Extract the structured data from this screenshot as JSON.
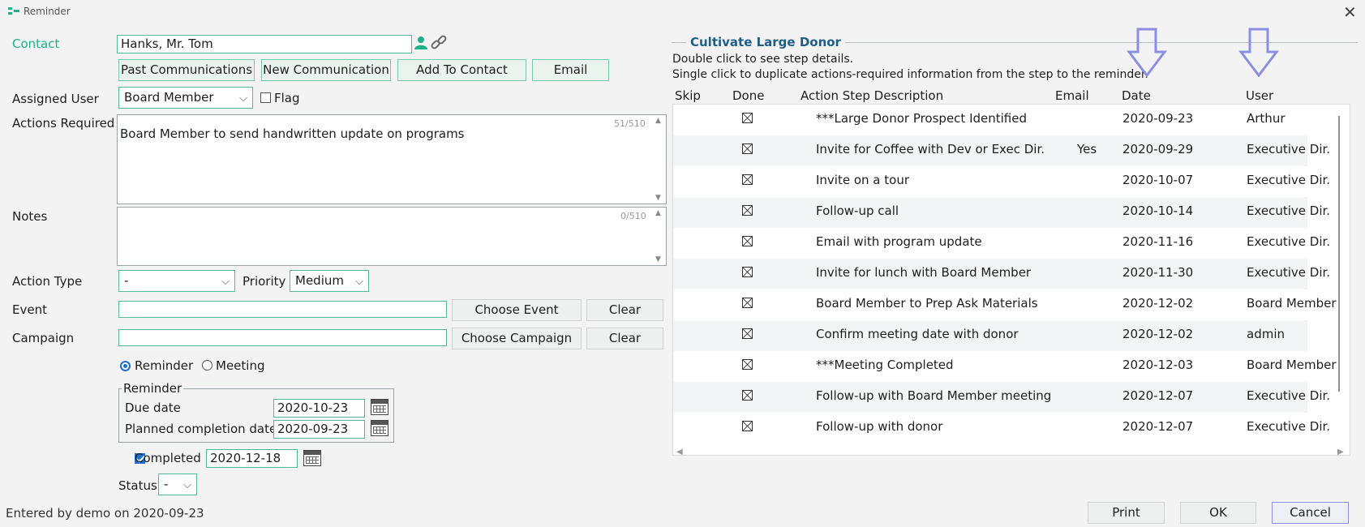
{
  "window": {
    "title": "Reminder",
    "close_icon": "close-icon"
  },
  "contact": {
    "label": "Contact",
    "value": "Hanks, Mr. Tom"
  },
  "contact_buttons": {
    "past": "Past Communications",
    "new": "New Communication",
    "add": "Add To Contact",
    "email": "Email"
  },
  "assigned_user": {
    "label": "Assigned User",
    "value": "Board Member",
    "flag_label": "Flag"
  },
  "actions_required": {
    "label": "Actions Required",
    "text": "Board Member to send handwritten update on programs",
    "counter": "51/510"
  },
  "notes": {
    "label": "Notes",
    "text": "",
    "counter": "0/510"
  },
  "action_type": {
    "label": "Action Type",
    "value": "-",
    "priority_label": "Priority",
    "priority_value": "Medium"
  },
  "event": {
    "label": "Event",
    "value": "",
    "choose": "Choose Event",
    "clear": "Clear"
  },
  "campaign": {
    "label": "Campaign",
    "value": "",
    "choose": "Choose Campaign",
    "clear": "Clear"
  },
  "mode": {
    "reminder": "Reminder",
    "meeting": "Meeting",
    "selected": "Reminder"
  },
  "reminder_group": {
    "title": "Reminder",
    "due_label": "Due date",
    "due_value": "2020-10-23",
    "planned_label": "Planned completion date",
    "planned_value": "2020-09-23"
  },
  "completed": {
    "label": "Completed",
    "value": "2020-12-18",
    "checked": true
  },
  "status": {
    "label": "Status",
    "value": "-"
  },
  "entered_by": "Entered by demo on 2020-09-23",
  "steps": {
    "title": "Cultivate Large Donor",
    "hint1": "Double click to see step details.",
    "hint2": "Single click to duplicate actions-required information from the step to the reminder.",
    "columns": {
      "skip": "Skip",
      "done": "Done",
      "desc": "Action Step Description",
      "email": "Email",
      "date": "Date",
      "user": "User"
    },
    "rows": [
      {
        "desc": "***Large Donor Prospect Identified",
        "email": "",
        "date": "2020-09-23",
        "user": "Arthur"
      },
      {
        "desc": "Invite for Coffee with Dev or Exec Dir.",
        "email": "Yes",
        "date": "2020-09-29",
        "user": "Executive Dir."
      },
      {
        "desc": "Invite on a tour",
        "email": "",
        "date": "2020-10-07",
        "user": "Executive Dir."
      },
      {
        "desc": "Follow-up call",
        "email": "",
        "date": "2020-10-14",
        "user": "Executive Dir."
      },
      {
        "desc": "Email with program update",
        "email": "",
        "date": "2020-11-16",
        "user": "Executive Dir."
      },
      {
        "desc": "Invite for lunch with Board Member",
        "email": "",
        "date": "2020-11-30",
        "user": "Executive Dir."
      },
      {
        "desc": "Board Member to Prep Ask Materials",
        "email": "",
        "date": "2020-12-02",
        "user": "Board Member"
      },
      {
        "desc": "Confirm meeting date with donor",
        "email": "",
        "date": "2020-12-02",
        "user": "admin"
      },
      {
        "desc": "***Meeting Completed",
        "email": "",
        "date": "2020-12-03",
        "user": "Board Member"
      },
      {
        "desc": "Follow-up with Board Member meeting",
        "email": "",
        "date": "2020-12-07",
        "user": "Executive Dir."
      },
      {
        "desc": "Follow-up with donor",
        "email": "",
        "date": "2020-12-07",
        "user": "Executive Dir."
      }
    ]
  },
  "footer": {
    "print": "Print",
    "ok": "OK",
    "cancel": "Cancel"
  },
  "colors": {
    "accent": "#1fb08a",
    "arrow": "#8c8fe0",
    "section": "#1e5f8a"
  }
}
